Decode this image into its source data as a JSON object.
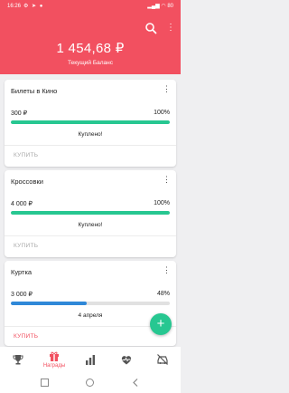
{
  "status_bar": {
    "time": "16:26",
    "battery": "80"
  },
  "header": {
    "balance": "1 454,68 ₽",
    "balance_label": "Текущий Баланс"
  },
  "colors": {
    "accent": "#f25060",
    "progress": "#27c791",
    "partial": "#2f88d8",
    "buy_disabled": "#aaaaaa"
  },
  "cards": [
    {
      "title": "Билеты в Кино",
      "amount": "300 ₽",
      "percent": "100%",
      "progress": 1.0,
      "status": "Куплено!",
      "buy_label": "КУПИТЬ"
    },
    {
      "title": "Кроссовки",
      "amount": "4 000 ₽",
      "percent": "100%",
      "progress": 1.0,
      "status": "Куплено!",
      "buy_label": "КУПИТЬ"
    },
    {
      "title": "Куртка",
      "amount": "3 000 ₽",
      "percent": "48%",
      "progress": 0.48,
      "status": "4 апреля",
      "buy_label": "КУПИТЬ"
    }
  ],
  "fab": {
    "label": "+"
  },
  "nav": {
    "active_label": "Награды"
  }
}
